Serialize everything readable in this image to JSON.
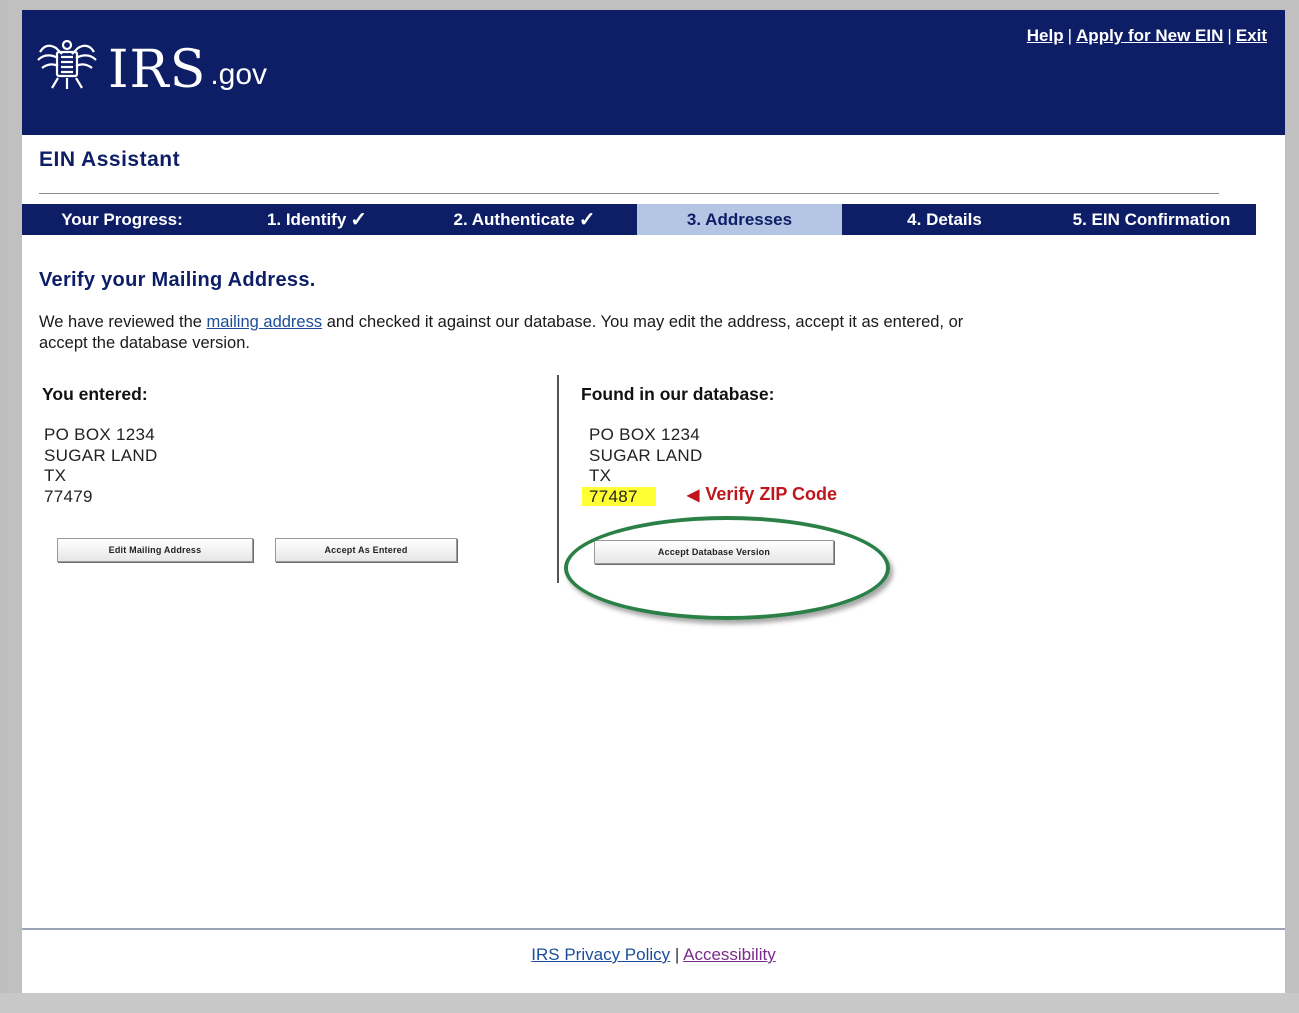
{
  "header": {
    "logo_text": "IRS",
    "logo_suffix": ".gov",
    "links": {
      "help": "Help",
      "apply": "Apply for New EIN",
      "exit": "Exit",
      "separator": "|"
    }
  },
  "app_title": "EIN Assistant",
  "progress": {
    "label": "Your Progress:",
    "steps": [
      {
        "label": "1. Identify",
        "done": true
      },
      {
        "label": "2. Authenticate",
        "done": true
      },
      {
        "label": "3. Addresses",
        "active": true
      },
      {
        "label": "4. Details"
      },
      {
        "label": "5. EIN Confirmation"
      }
    ],
    "check_glyph": "✓"
  },
  "page_heading": "Verify your Mailing Address.",
  "intro": {
    "before": "We have reviewed the ",
    "link": "mailing address",
    "after": " and checked it against our database. You may edit the address, accept it as entered, or accept the database version."
  },
  "entered": {
    "title": "You entered:",
    "lines": [
      "PO BOX 1234",
      "SUGAR LAND",
      "TX",
      "77479"
    ],
    "buttons": {
      "edit": "Edit Mailing Address",
      "accept": "Accept As Entered"
    }
  },
  "database": {
    "title": "Found in our database:",
    "lines": [
      "PO BOX 1234",
      "SUGAR LAND",
      "TX",
      "77487"
    ],
    "verify_note": "Verify ZIP Code",
    "verify_arrow": "◀",
    "button": "Accept Database Version"
  },
  "footer": {
    "privacy": "IRS Privacy Policy",
    "separator": "|",
    "accessibility": "Accessibility"
  },
  "colors": {
    "brand_navy": "#0d1e67",
    "active_step": "#b5c5e4",
    "zip_highlight": "#ffff33",
    "annotation_red": "#c0161d",
    "annotation_circle": "#2b8046"
  }
}
